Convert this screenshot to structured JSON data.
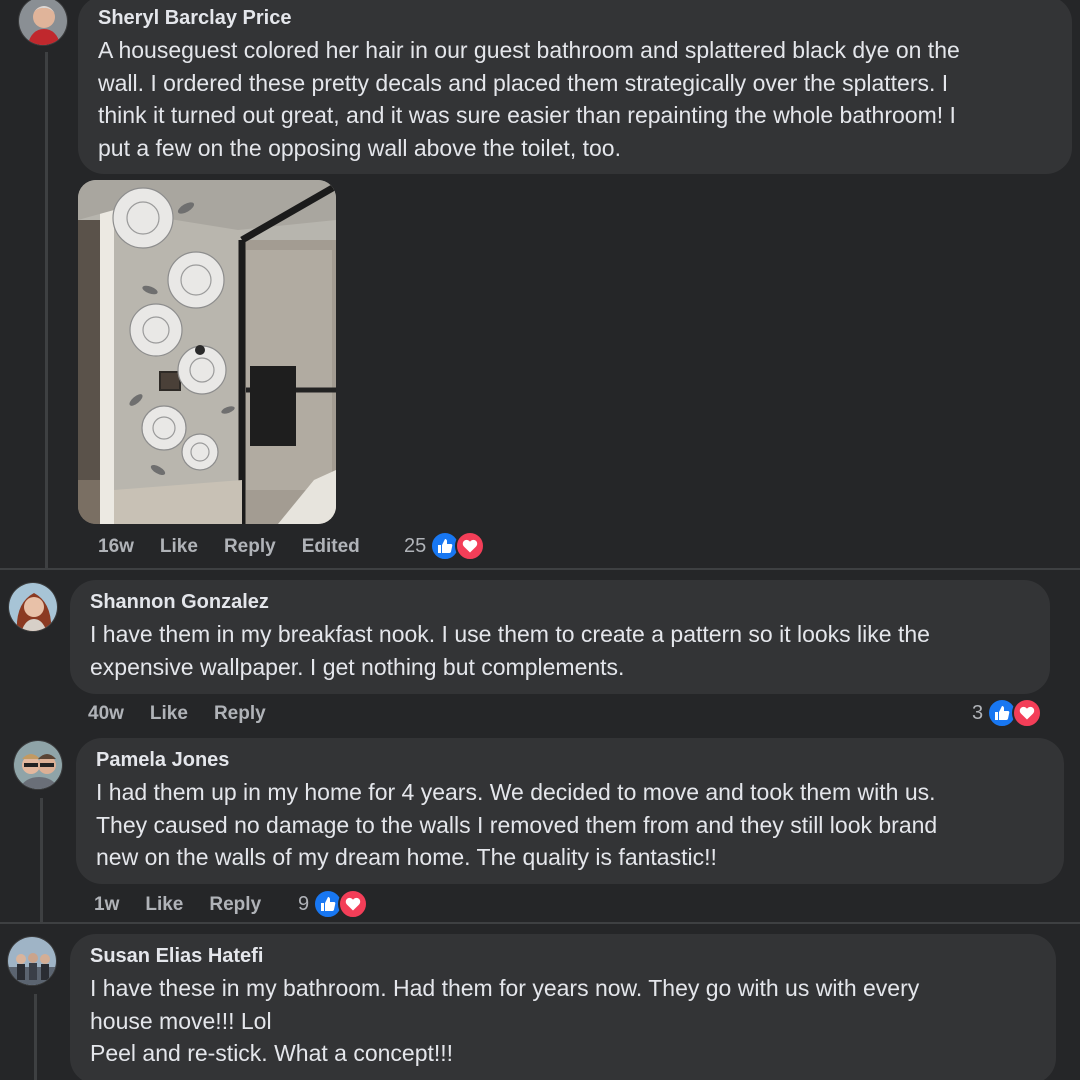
{
  "comments": [
    {
      "author": "Sheryl Barclay Price",
      "text": "A houseguest colored her hair in our guest bathroom and splattered black dye on the\nwall. I ordered these pretty decals and placed them strategically over the splatters. I\nthink it turned out great, and it was sure easier than repainting the whole bathroom! I\nput a few on the opposing wall above the toilet, too.",
      "time": "16w",
      "like": "Like",
      "reply": "Reply",
      "edited": "Edited",
      "reactions": "25"
    },
    {
      "author": "Shannon Gonzalez",
      "text": "I have them in my breakfast nook. I use them to create a pattern so it looks like the\nexpensive wallpaper. I get nothing but complements.",
      "time": "40w",
      "like": "Like",
      "reply": "Reply",
      "reactions": "3"
    },
    {
      "author": "Pamela Jones",
      "text": "I had them up in my home for 4 years. We decided to move and took them with us.\nThey caused no damage to the walls I removed them from and they still look brand\nnew on the walls of my dream home. The quality is fantastic!!",
      "time": "1w",
      "like": "Like",
      "reply": "Reply",
      "reactions": "9"
    },
    {
      "author": "Susan Elias Hatefi",
      "text": "I have these in my bathroom. Had them for years now. They go with us with every\nhouse move!!! Lol\nPeel and re-stick. What a concept!!!"
    }
  ],
  "icons": {
    "like": "thumbs-up-icon",
    "love": "heart-icon"
  },
  "colors": {
    "background": "#252628",
    "bubble": "#333436",
    "like_blue": "#1877f2",
    "love_red": "#f33e58",
    "secondary_text": "#b0b3b8"
  }
}
